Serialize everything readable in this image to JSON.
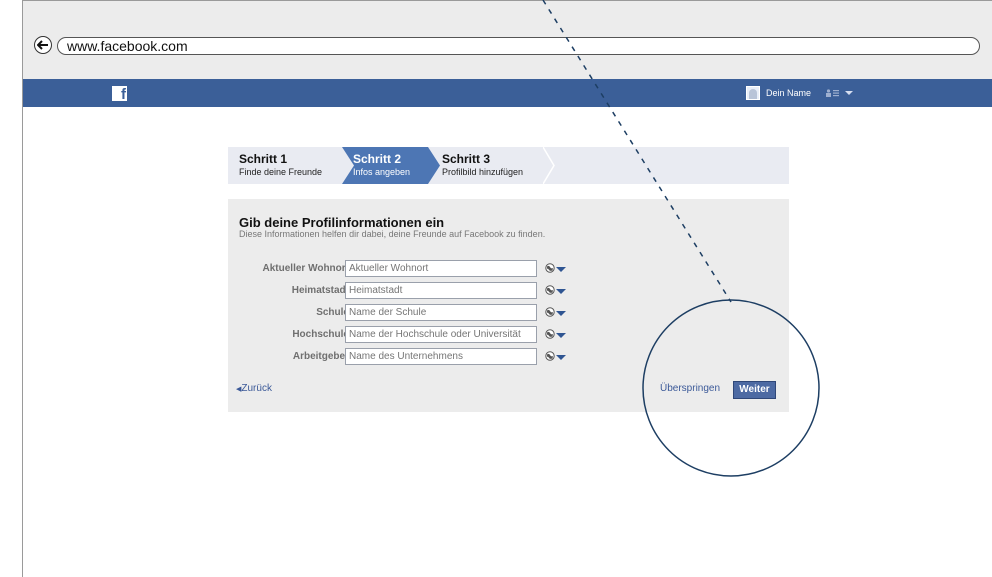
{
  "browser": {
    "url": "www.facebook.com"
  },
  "header": {
    "user_name": "Dein Name"
  },
  "steps": [
    {
      "title": "Schritt 1",
      "subtitle": "Finde deine Freunde",
      "active": false
    },
    {
      "title": "Schritt 2",
      "subtitle": "Infos angeben",
      "active": true
    },
    {
      "title": "Schritt 3",
      "subtitle": "Profilbild hinzufügen",
      "active": false
    }
  ],
  "form": {
    "title": "Gib deine Profilinformationen ein",
    "subtitle": "Diese Informationen helfen dir dabei, deine Freunde auf Facebook zu finden.",
    "fields": [
      {
        "label": "Aktueller Wohnort",
        "placeholder": "Aktueller Wohnort",
        "value": ""
      },
      {
        "label": "Heimatstadt",
        "placeholder": "Heimatstadt",
        "value": ""
      },
      {
        "label": "Schule",
        "placeholder": "Name der Schule",
        "value": ""
      },
      {
        "label": "Hochschule",
        "placeholder": "Name der Hochschule oder Universität",
        "value": ""
      },
      {
        "label": "Arbeitgeber",
        "placeholder": "Name des Unternehmens",
        "value": ""
      }
    ],
    "back_label": "Zurück",
    "skip_label": "Überspringen",
    "next_label": "Weiter"
  },
  "icons": {
    "back": "back-arrow-icon",
    "logo": "facebook-logo-icon",
    "avatar": "avatar-icon",
    "friends": "friend-requests-icon",
    "privacy": "globe-icon"
  },
  "colors": {
    "facebook_blue": "#3b5f98",
    "active_step": "#4d76b4",
    "button": "#4d6aa3",
    "link": "#3b5998",
    "annotation": "#1d3e63"
  }
}
